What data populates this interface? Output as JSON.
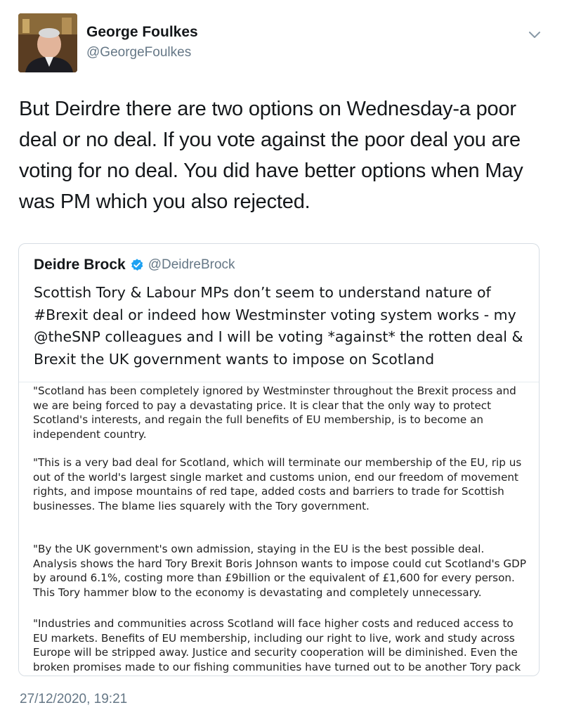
{
  "tweet": {
    "author": {
      "name": "George Foulkes",
      "handle": "@GeorgeFoulkes"
    },
    "text": "But Deirdre there are two options on Wednesday-a poor deal or no deal. If you vote against the poor deal you are voting for no deal. You did have better options when May was PM which you also rejected.",
    "timestamp": "27/12/2020, 19:21"
  },
  "quoted": {
    "author": {
      "name": "Deidre Brock",
      "handle": "@DeidreBrock",
      "verified": true
    },
    "text": "Scottish Tory & Labour MPs don’t seem to understand nature of #Brexit deal or indeed how Westminster voting system works - my @theSNP colleagues and I will be voting *against* the rotten deal & Brexit the UK government wants to impose on Scotland",
    "media_paragraphs": [
      "\"Scotland has been completely ignored by Westminster throughout the Brexit process and we are being forced to pay a devastating price. It is clear that the only way to protect Scotland's interests, and regain the full benefits of EU membership, is to become an independent country.",
      "\"This is a very bad deal for Scotland, which will terminate our membership of the EU, rip us out of the world's largest single market and customs union, end our freedom of movement rights, and impose mountains of red tape, added costs and barriers to trade for Scottish businesses. The blame lies squarely with the Tory government.",
      "\"By the UK government's own admission, staying in the EU is the best possible deal. Analysis shows the hard Tory Brexit Boris Johnson wants to impose could cut Scotland's GDP by around 6.1%, costing more than £9billion or the equivalent of £1,600 for every person. This Tory hammer blow to the economy is devastating and completely unnecessary.",
      "\"Industries and communities across Scotland will face higher costs and reduced access to EU markets. Benefits of EU membership, including our right to live, work and study across Europe will be stripped away. Justice and security cooperation will be diminished. Even the broken promises made to our fishing communities have turned out to be another Tory pack"
    ]
  },
  "icons": {
    "caret": "chevron-down-icon",
    "verified": "verified-badge-icon",
    "avatar": "profile-photo"
  },
  "colors": {
    "text": "#14171a",
    "secondary": "#657786",
    "verified": "#1da1f2",
    "border": "#d6dde3"
  }
}
